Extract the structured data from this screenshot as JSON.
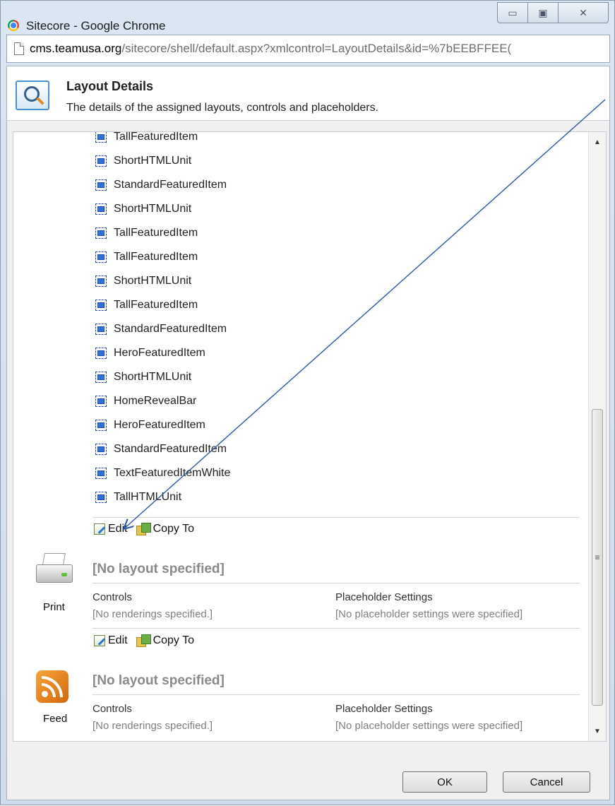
{
  "window": {
    "title": "Sitecore - Google Chrome",
    "minimize_symbol": "▭",
    "maximize_symbol": "▣",
    "close_symbol": "✕"
  },
  "address": {
    "host": "cms.teamusa.org",
    "path": "/sitecore/shell/default.aspx?xmlcontrol=LayoutDetails&id=%7bEEBFFEE("
  },
  "header": {
    "title": "Layout Details",
    "description": "The details of the assigned layouts, controls and placeholders."
  },
  "renderings": [
    "TallFeaturedItem",
    "ShortHTMLUnit",
    "StandardFeaturedItem",
    "ShortHTMLUnit",
    "TallFeaturedItem",
    "TallFeaturedItem",
    "ShortHTMLUnit",
    "TallFeaturedItem",
    "StandardFeaturedItem",
    "HeroFeaturedItem",
    "ShortHTMLUnit",
    "HomeRevealBar",
    "HeroFeaturedItem",
    "StandardFeaturedItem",
    "TextFeaturedItemWhite",
    "TallHTMLUnit"
  ],
  "actions": {
    "edit_label": "Edit",
    "copy_label": "Copy To"
  },
  "devices": [
    {
      "name": "Print",
      "layout": "[No layout specified]",
      "controls_header": "Controls",
      "controls_value": "[No renderings specified.]",
      "placeholder_header": "Placeholder Settings",
      "placeholder_value": "[No placeholder settings were specified]"
    },
    {
      "name": "Feed",
      "layout": "[No layout specified]",
      "controls_header": "Controls",
      "controls_value": "[No renderings specified.]",
      "placeholder_header": "Placeholder Settings",
      "placeholder_value": "[No placeholder settings were specified]"
    }
  ],
  "buttons": {
    "ok": "OK",
    "cancel": "Cancel"
  },
  "scrollbar": {
    "up": "▲",
    "down": "▼",
    "grip": "≡"
  },
  "colors": {
    "annotation_arrow": "#2e57a5",
    "rendering_icon": "#2f72d8",
    "no_layout_text": "#8a8a8a"
  }
}
